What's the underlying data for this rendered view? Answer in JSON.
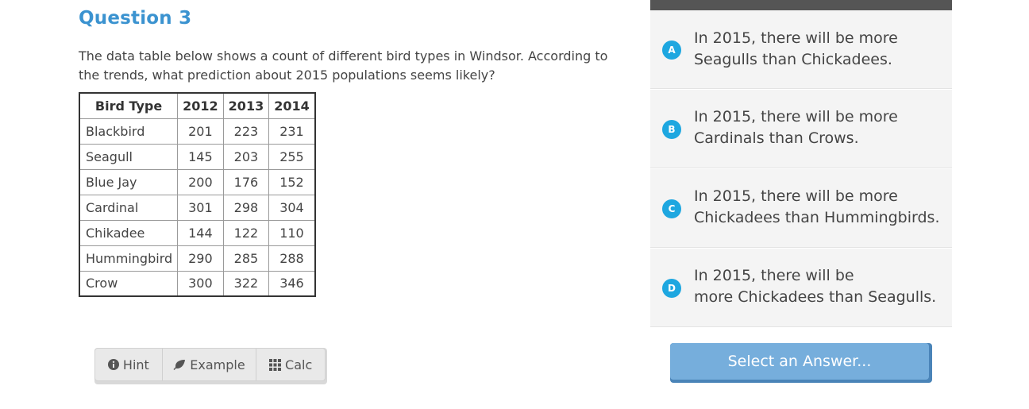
{
  "question": {
    "title": "Question 3",
    "prompt": "The data table below shows a count of different bird types in Windsor. According to the trends, what prediction about 2015 populations seems likely?"
  },
  "table": {
    "headers": [
      "Bird Type",
      "2012",
      "2013",
      "2014"
    ],
    "rows": [
      {
        "name": "Blackbird",
        "values": [
          "201",
          "223",
          "231"
        ]
      },
      {
        "name": "Seagull",
        "values": [
          "145",
          "203",
          "255"
        ]
      },
      {
        "name": "Blue Jay",
        "values": [
          "200",
          "176",
          "152"
        ]
      },
      {
        "name": "Cardinal",
        "values": [
          "301",
          "298",
          "304"
        ]
      },
      {
        "name": "Chikadee",
        "values": [
          "144",
          "122",
          "110"
        ]
      },
      {
        "name": "Hummingbird",
        "values": [
          "290",
          "285",
          "288"
        ]
      },
      {
        "name": "Crow",
        "values": [
          "300",
          "322",
          "346"
        ]
      }
    ]
  },
  "toolbar": {
    "hint_label": "Hint",
    "example_label": "Example",
    "calc_label": "Calc",
    "hint_icon": "info-circle-icon",
    "example_icon": "leaf-icon",
    "calc_icon": "grid-icon"
  },
  "answers": {
    "choices": [
      {
        "letter": "A",
        "line1": "In 2015, there will be more",
        "line2": "Seagulls than Chickadees."
      },
      {
        "letter": "B",
        "line1": "In 2015, there will be more",
        "line2": "Cardinals than Crows."
      },
      {
        "letter": "C",
        "line1": "In 2015, there will be more",
        "line2": "Chickadees than Hummingbirds."
      },
      {
        "letter": "D",
        "line1": "In 2015, there will be",
        "line2": "more Chickadees than Seagulls."
      }
    ],
    "select_label": "Select an Answer..."
  },
  "colors": {
    "title": "#3b93d0",
    "badge": "#1ea7e0",
    "select_button": "#76aedc",
    "answers_topbar": "#555555"
  }
}
